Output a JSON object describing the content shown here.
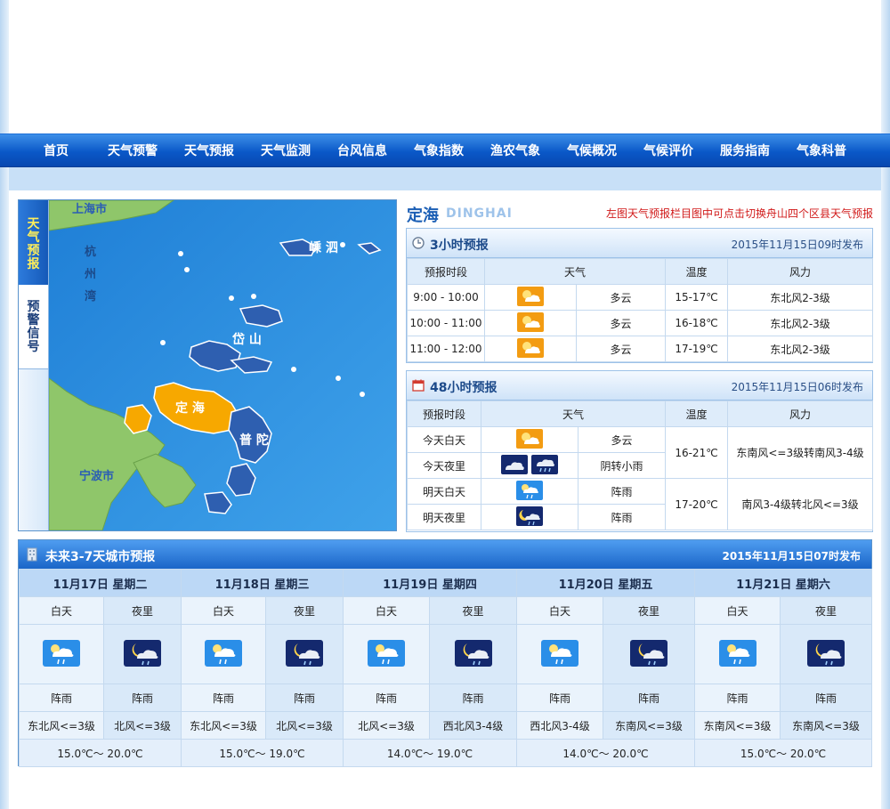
{
  "nav": {
    "items": [
      "首页",
      "天气预警",
      "天气预报",
      "天气监测",
      "台风信息",
      "气象指数",
      "渔农气象",
      "气候概况",
      "气候评价",
      "服务指南",
      "气象科普"
    ]
  },
  "map_tabs": {
    "forecast": "天气预报",
    "warning": "预警信号"
  },
  "map": {
    "labels": {
      "shanghai": "上海市",
      "hangzhou_bay": [
        "杭",
        "州",
        "湾"
      ],
      "shengsi": "嵊泗",
      "daishan": "岱山",
      "dinghai": "定海",
      "putuo": "普陀",
      "ningbo": "宁波市"
    }
  },
  "city": {
    "name": "定海",
    "pinyin": "DINGHAI",
    "tip": "左图天气预报栏目图中可点击切换舟山四个区县天气预报"
  },
  "forecast3h": {
    "title": "3小时预报",
    "published": "2015年11月15日09时发布",
    "headers": [
      "预报时段",
      "天气",
      "温度",
      "风力"
    ],
    "rows": [
      {
        "period": "9:00 - 10:00",
        "icon": "partly-cloudy-icon",
        "weather": "多云",
        "temp": "15-17℃",
        "wind": "东北风2-3级"
      },
      {
        "period": "10:00 - 11:00",
        "icon": "partly-cloudy-icon",
        "weather": "多云",
        "temp": "16-18℃",
        "wind": "东北风2-3级"
      },
      {
        "period": "11:00 - 12:00",
        "icon": "partly-cloudy-icon",
        "weather": "多云",
        "temp": "17-19℃",
        "wind": "东北风2-3级"
      }
    ]
  },
  "forecast48h": {
    "title": "48小时预报",
    "published": "2015年11月15日06时发布",
    "headers": [
      "预报时段",
      "天气",
      "温度",
      "风力"
    ],
    "rows": [
      {
        "period": "今天白天",
        "weather": "多云"
      },
      {
        "period": "今天夜里",
        "weather": "阴转小雨"
      },
      {
        "period": "明天白天",
        "weather": "阵雨"
      },
      {
        "period": "明天夜里",
        "weather": "阵雨"
      }
    ],
    "today_temp": "16-21℃",
    "today_wind": "东南风<=3级转南风3-4级",
    "tomorrow_temp": "17-20℃",
    "tomorrow_wind": "南风3-4级转北风<=3级"
  },
  "days": {
    "title": "未来3-7天城市预报",
    "published": "2015年11月15日07时发布",
    "day_label": "白天",
    "night_label": "夜里",
    "items": [
      {
        "date": "11月17日  星期二",
        "day_wx": "阵雨",
        "night_wx": "阵雨",
        "day_wind": "东北风<=3级",
        "night_wind": "北风<=3级",
        "temp": "15.0℃～ 20.0℃"
      },
      {
        "date": "11月18日  星期三",
        "day_wx": "阵雨",
        "night_wx": "阵雨",
        "day_wind": "东北风<=3级",
        "night_wind": "北风<=3级",
        "temp": "15.0℃～ 19.0℃"
      },
      {
        "date": "11月19日  星期四",
        "day_wx": "阵雨",
        "night_wx": "阵雨",
        "day_wind": "北风<=3级",
        "night_wind": "西北风3-4级",
        "temp": "14.0℃～ 19.0℃"
      },
      {
        "date": "11月20日  星期五",
        "day_wx": "阵雨",
        "night_wx": "阵雨",
        "day_wind": "西北风3-4级",
        "night_wind": "东南风<=3级",
        "temp": "14.0℃～ 20.0℃"
      },
      {
        "date": "11月21日  星期六",
        "day_wx": "阵雨",
        "night_wx": "阵雨",
        "day_wind": "东南风<=3级",
        "night_wind": "东南风<=3级",
        "temp": "15.0℃～ 20.0℃"
      }
    ]
  },
  "colors": {
    "nav": "#0a58c8",
    "accent_orange": "#f7a800",
    "tip_red": "#d11a1a",
    "sea": "#2f8ee0"
  }
}
